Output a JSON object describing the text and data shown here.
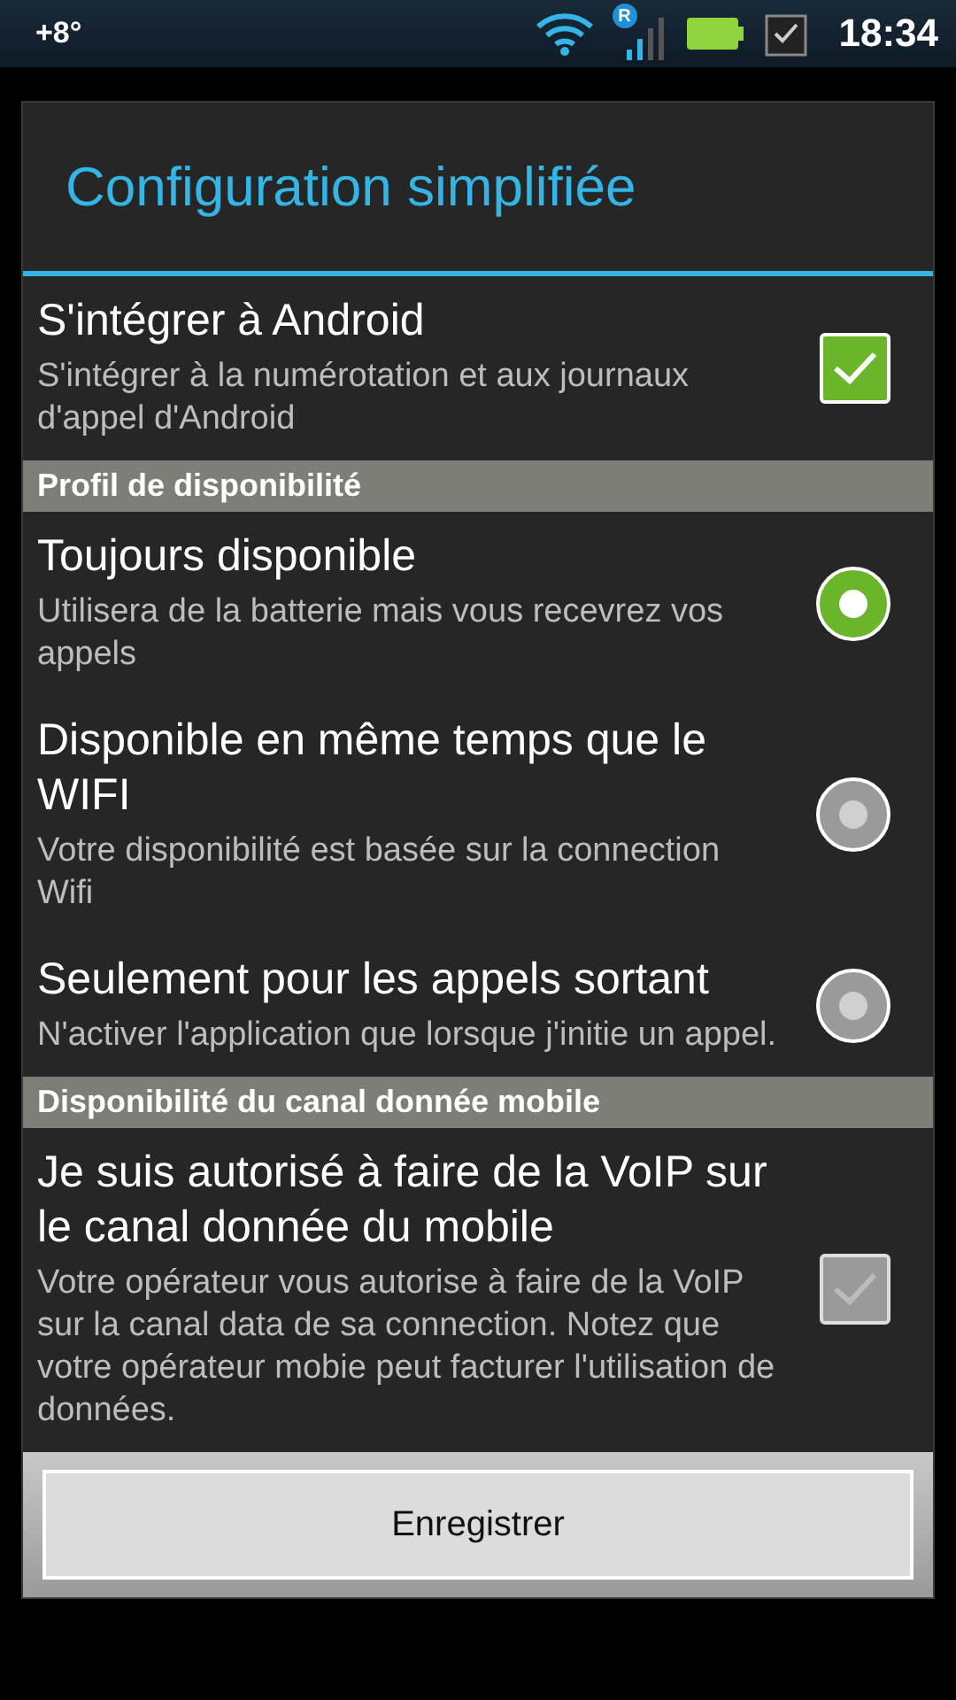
{
  "status_bar": {
    "temperature": "+8°",
    "roaming_badge": "R",
    "time": "18:34"
  },
  "dialog": {
    "title": "Configuration simplifiée",
    "items": [
      {
        "kind": "checkbox",
        "title": "S'intégrer à Android",
        "summary": "S'intégrer à la numérotation et aux journaux d'appel d'Android",
        "checked": true,
        "disabled": false
      },
      {
        "kind": "header",
        "title": "Profil de disponibilité"
      },
      {
        "kind": "radio",
        "title": "Toujours disponible",
        "summary": "Utilisera de la batterie mais vous recevrez vos appels",
        "selected": true
      },
      {
        "kind": "radio",
        "title": "Disponible en même temps que le WIFI",
        "summary": "Votre disponibilité est basée sur la connection Wifi",
        "selected": false
      },
      {
        "kind": "radio",
        "title": "Seulement pour les appels sortant",
        "summary": "N'activer l'application que lorsque j'initie un appel.",
        "selected": false
      },
      {
        "kind": "header",
        "title": "Disponibilité du canal donnée mobile"
      },
      {
        "kind": "checkbox",
        "title": "Je suis autorisé à faire de la VoIP sur le canal donnée du mobile",
        "summary": "Votre opérateur vous autorise à faire de la VoIP sur la canal data de sa connection. Notez que votre opérateur mobie peut facturer l'utilisation de données.",
        "checked": true,
        "disabled": true
      }
    ],
    "button": "Enregistrer"
  }
}
